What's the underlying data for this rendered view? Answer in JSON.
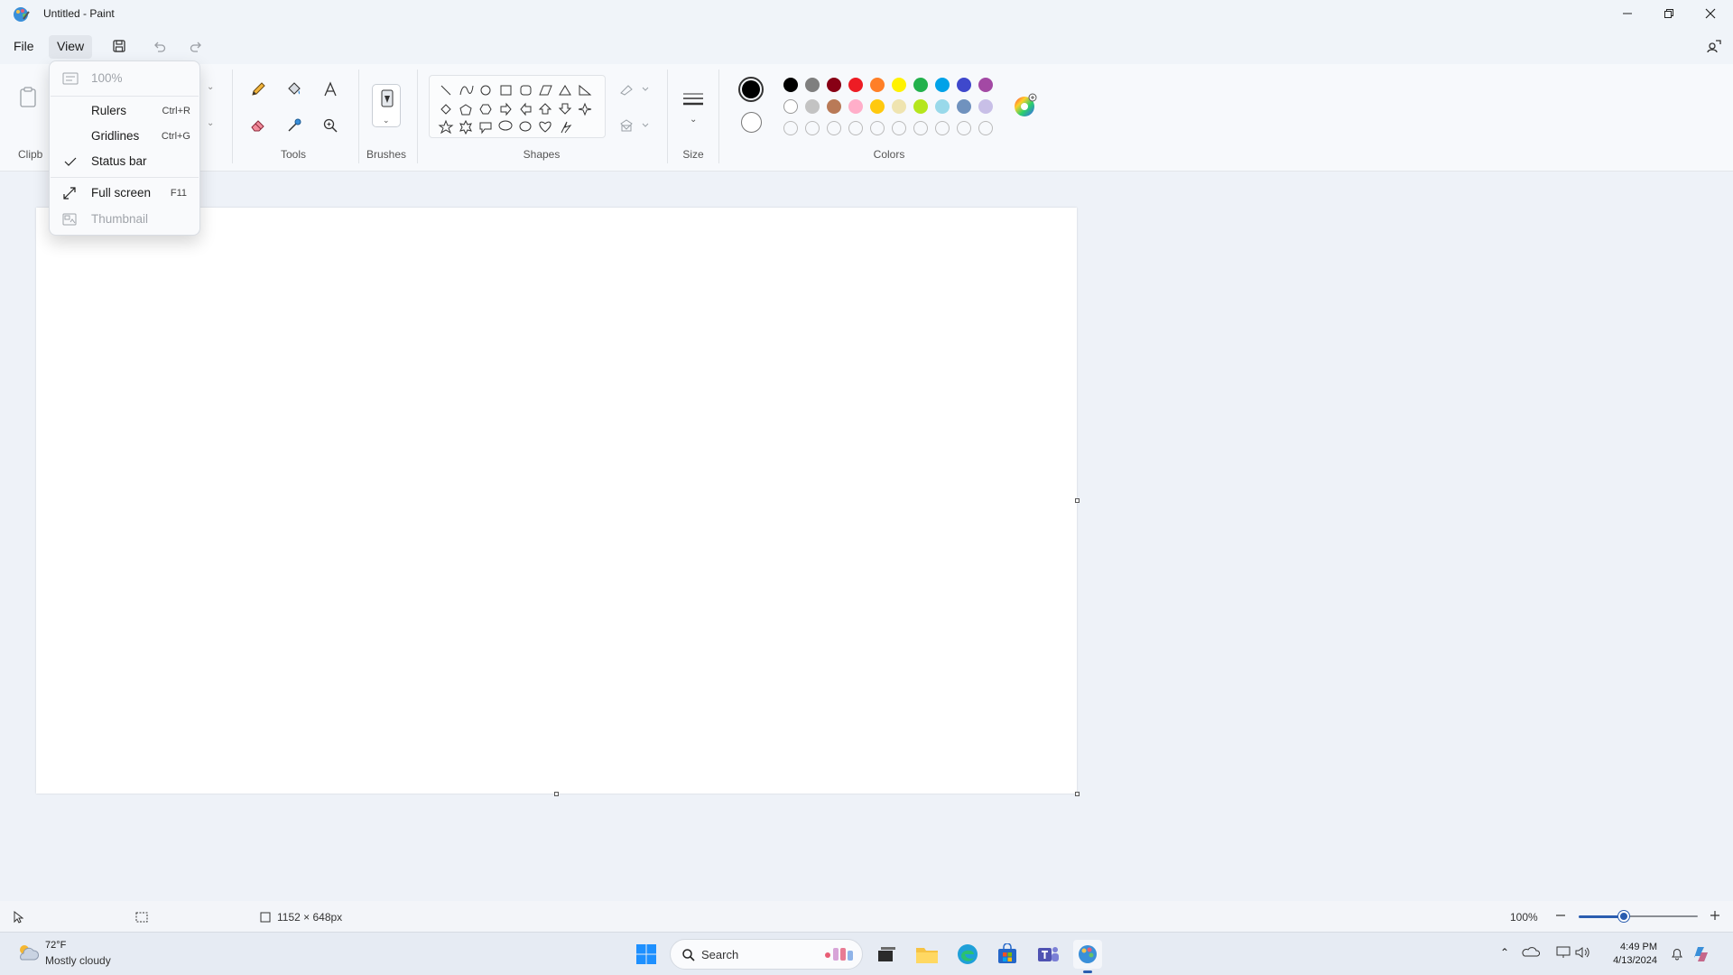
{
  "window": {
    "title": "Untitled - Paint"
  },
  "menubar": {
    "file": "File",
    "view": "View"
  },
  "ribbon": {
    "groups": {
      "clipboard": "Clipb",
      "tools": "Tools",
      "brushes": "Brushes",
      "shapes": "Shapes",
      "size": "Size",
      "colors": "Colors"
    },
    "colors": {
      "row1": [
        "#000000",
        "#7f7f7f",
        "#880015",
        "#ed1c24",
        "#ff7f27",
        "#fff200",
        "#22b14c",
        "#00a2e8",
        "#3f48cc",
        "#a349a4"
      ],
      "row2": [
        "#ffffff",
        "#c3c3c3",
        "#b97a57",
        "#ffaec9",
        "#ffc90e",
        "#efe4b0",
        "#b5e61d",
        "#99d9ea",
        "#7092be",
        "#c8bfe7"
      ],
      "primary": "#000000",
      "secondary": "#ffffff"
    }
  },
  "view_menu": {
    "zoom": "100%",
    "rulers": {
      "label": "Rulers",
      "shortcut": "Ctrl+R"
    },
    "gridlines": {
      "label": "Gridlines",
      "shortcut": "Ctrl+G"
    },
    "status_bar": {
      "label": "Status bar",
      "checked": true
    },
    "full_screen": {
      "label": "Full screen",
      "shortcut": "F11"
    },
    "thumbnail": {
      "label": "Thumbnail"
    }
  },
  "statusbar": {
    "canvas_size": "1152 × 648px",
    "zoom": "100%"
  },
  "taskbar": {
    "weather_temp": "72°F",
    "weather_desc": "Mostly cloudy",
    "search": "Search",
    "time": "4:49 PM",
    "date": "4/13/2024"
  }
}
